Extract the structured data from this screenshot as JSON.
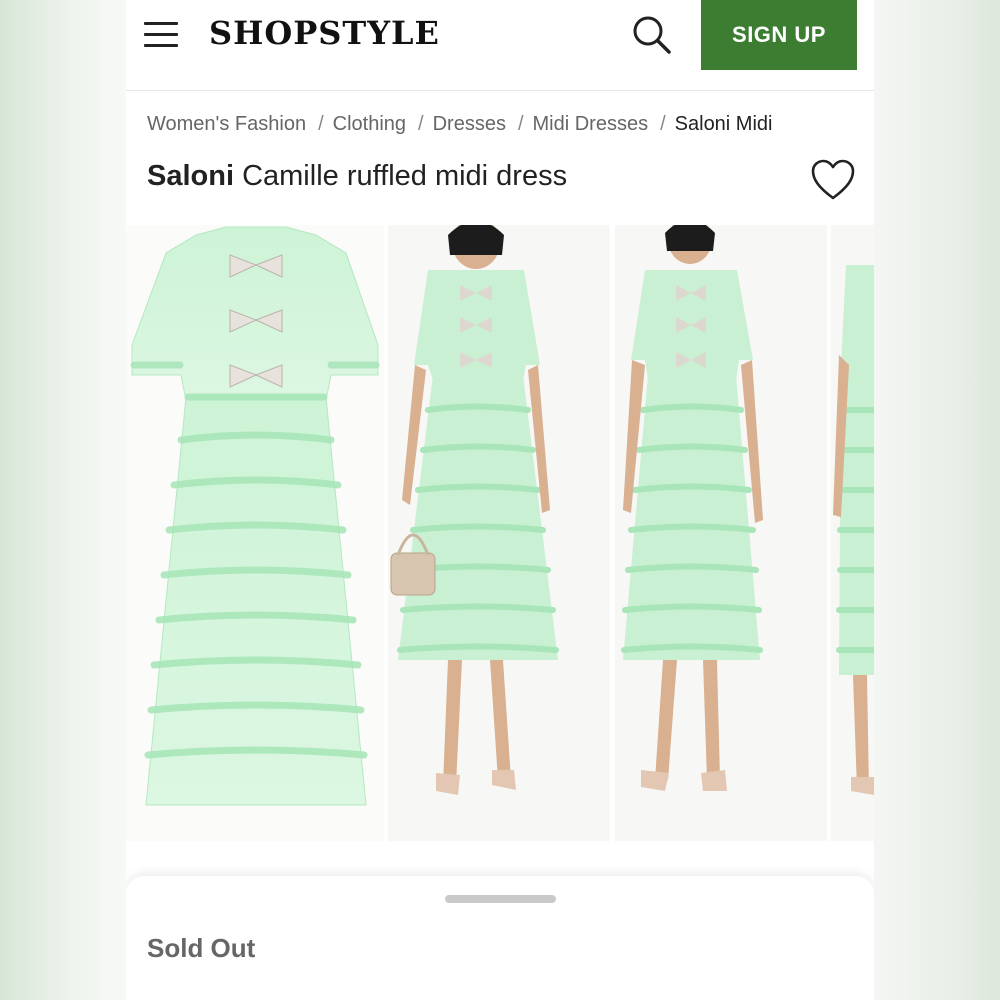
{
  "header": {
    "logo": "SHOPSTYLE",
    "signup_label": "SIGN UP",
    "menu_icon": "hamburger-menu-icon",
    "search_icon": "search-icon"
  },
  "breadcrumb": [
    {
      "label": "Women's Fashion"
    },
    {
      "label": "Clothing"
    },
    {
      "label": "Dresses"
    },
    {
      "label": "Midi Dresses"
    },
    {
      "label": "Saloni Midi"
    }
  ],
  "breadcrumb_separator": "/",
  "product": {
    "brand": "Saloni",
    "name": "Camille ruffled midi dress",
    "favorite_icon": "heart-outline-icon"
  },
  "status": {
    "label": "Sold Out"
  },
  "colors": {
    "accent": "#3d7d32",
    "dress": "#c8f0d2"
  }
}
